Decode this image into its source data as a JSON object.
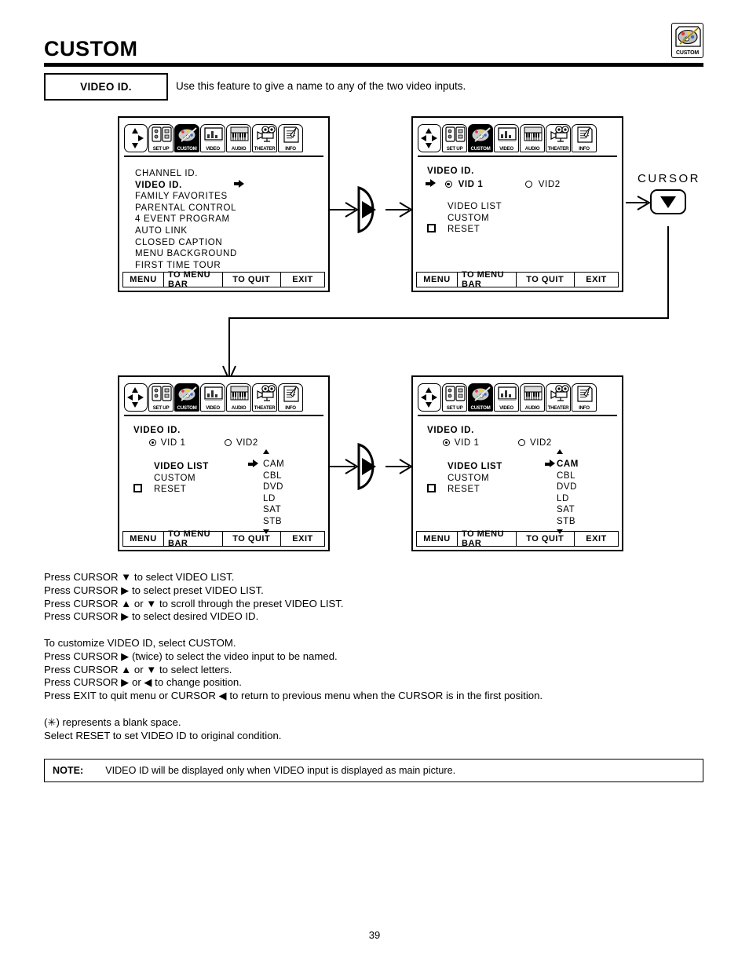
{
  "page": {
    "title": "CUSTOM",
    "number": "39",
    "badge": {
      "label": "CUSTOM",
      "icon": "palette-icon"
    }
  },
  "feature": {
    "name": "VIDEO ID.",
    "description": "Use this feature to give a name to any of the two video inputs."
  },
  "menu_bar": {
    "tabs": [
      {
        "label": "",
        "icon": "cursor-pad-icon",
        "active": false
      },
      {
        "label": "SET UP",
        "icon": "setup-icon",
        "active": false
      },
      {
        "label": "CUSTOM",
        "icon": "palette-icon",
        "active": true
      },
      {
        "label": "VIDEO",
        "icon": "video-monitor-icon",
        "active": false
      },
      {
        "label": "AUDIO",
        "icon": "audio-keyboard-icon",
        "active": false
      },
      {
        "label": "THEATER",
        "icon": "theater-projector-icon",
        "active": false
      },
      {
        "label": "INFO",
        "icon": "info-document-icon",
        "active": false
      }
    ]
  },
  "footer": {
    "menu": "MENU",
    "to_menu_bar": "TO MENU BAR",
    "to_quit": "TO QUIT",
    "exit": "EXIT"
  },
  "screen1": {
    "items": [
      {
        "label": "CHANNEL ID.",
        "selected": false,
        "arrow": false
      },
      {
        "label": "VIDEO ID.",
        "selected": true,
        "arrow": true
      },
      {
        "label": "FAMILY FAVORITES",
        "selected": false,
        "arrow": false
      },
      {
        "label": "PARENTAL CONTROL",
        "selected": false,
        "arrow": false
      },
      {
        "label": "4 EVENT PROGRAM",
        "selected": false,
        "arrow": false
      },
      {
        "label": "AUTO LINK",
        "selected": false,
        "arrow": false
      },
      {
        "label": "CLOSED CAPTION",
        "selected": false,
        "arrow": false
      },
      {
        "label": "MENU BACKGROUND",
        "selected": false,
        "arrow": false
      },
      {
        "label": "FIRST TIME TOUR",
        "selected": false,
        "arrow": false
      }
    ]
  },
  "screen2": {
    "heading": "VIDEO ID.",
    "vid1": "VID 1",
    "vid2": "VID2",
    "video_list": "VIDEO LIST",
    "custom": "CUSTOM",
    "reset": "RESET"
  },
  "screen3": {
    "heading": "VIDEO ID.",
    "vid1": "VID 1",
    "vid2": "VID2",
    "video_list": "VIDEO  LIST",
    "custom": "CUSTOM",
    "reset": "RESET",
    "presets": [
      "CAM",
      "CBL",
      "DVD",
      "LD",
      "SAT",
      "STB"
    ]
  },
  "screen4": {
    "heading": "VIDEO ID.",
    "vid1": "VID 1",
    "vid2": "VID2",
    "video_list": "VIDEO  LIST",
    "custom": "CUSTOM",
    "reset": "RESET",
    "presets": [
      "CAM",
      "CBL",
      "DVD",
      "LD",
      "SAT",
      "STB"
    ],
    "selected_preset": "CAM"
  },
  "cursor_widget": {
    "label": "CURSOR",
    "direction": "down"
  },
  "instructions": {
    "block1": [
      "Press CURSOR ▼ to select VIDEO LIST.",
      "Press CURSOR ▶ to select preset VIDEO LIST.",
      "Press CURSOR ▲ or ▼ to scroll through the preset VIDEO LIST.",
      "Press CURSOR ▶ to select desired VIDEO ID."
    ],
    "block2": [
      "To customize VIDEO ID, select CUSTOM.",
      "Press CURSOR ▶ (twice) to select the video input to be named.",
      "Press CURSOR ▲ or ▼ to select letters.",
      "Press CURSOR ▶ or ◀ to change position.",
      "Press EXIT to quit menu or CURSOR ◀ to return to previous menu when the CURSOR is in the first position."
    ],
    "block3": [
      "(✳) represents a blank space.",
      "Select RESET to set VIDEO ID to original condition."
    ]
  },
  "note": {
    "label": "NOTE:",
    "text": "VIDEO ID will be displayed only when VIDEO input is displayed as main picture."
  }
}
